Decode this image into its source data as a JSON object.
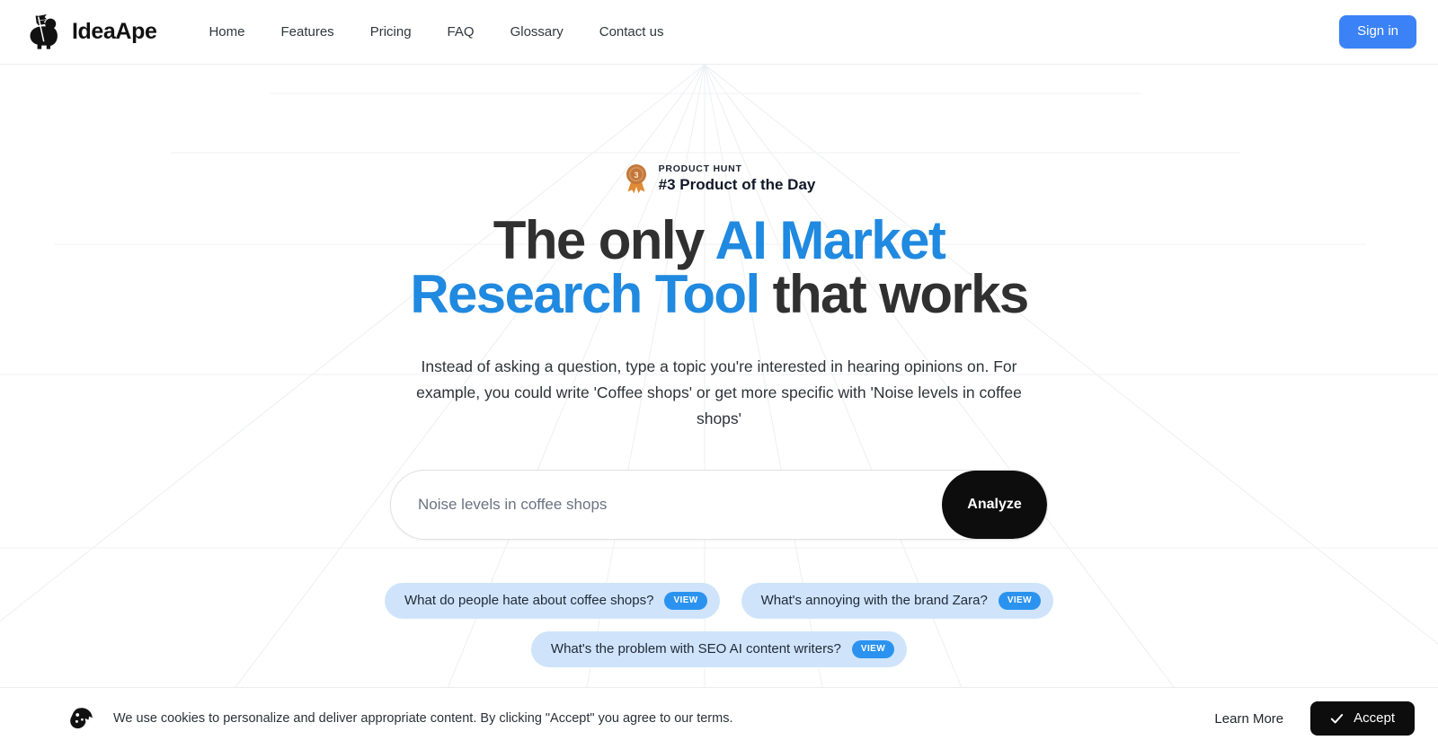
{
  "brand": {
    "name": "IdeaApe",
    "logo_icon": "ape-with-flag-icon"
  },
  "header": {
    "nav": [
      {
        "label": "Home"
      },
      {
        "label": "Features"
      },
      {
        "label": "Pricing"
      },
      {
        "label": "FAQ"
      },
      {
        "label": "Glossary"
      },
      {
        "label": "Contact us"
      }
    ],
    "signin_label": "Sign in"
  },
  "hero": {
    "badge": {
      "icon": "bronze-medal-icon",
      "medal_number": "3",
      "kicker": "PRODUCT HUNT",
      "title": "#3 Product of the Day"
    },
    "headline_part1": "The only ",
    "headline_accent": "AI Market Research Tool",
    "headline_part2": " that works",
    "subhead": "Instead of asking a question, type a topic you're interested in hearing opinions on. For example, you could write 'Coffee shops' or get more specific with 'Noise levels in coffee shops'",
    "search": {
      "value": "",
      "placeholder": "Noise levels in coffee shops",
      "submit_label": "Analyze"
    },
    "suggestions": [
      {
        "label": "What do people hate about coffee shops?",
        "action": "VIEW"
      },
      {
        "label": "What's annoying with the brand Zara?",
        "action": "VIEW"
      },
      {
        "label": "What's the problem with SEO AI content writers?",
        "action": "VIEW"
      }
    ]
  },
  "cookie_banner": {
    "icon": "cookie-icon",
    "message": "We use cookies to personalize and deliver appropriate content. By clicking \"Accept\" you agree to our terms.",
    "learn_more_label": "Learn More",
    "accept_label": "Accept",
    "accept_icon": "check-icon"
  },
  "colors": {
    "accent_blue": "#2089e0",
    "button_blue": "#3b82f6",
    "chip_bg": "#cfe4fb",
    "chip_badge": "#2b93ef",
    "black": "#0d0d0d",
    "medal_bronze": "#c97b3f"
  }
}
